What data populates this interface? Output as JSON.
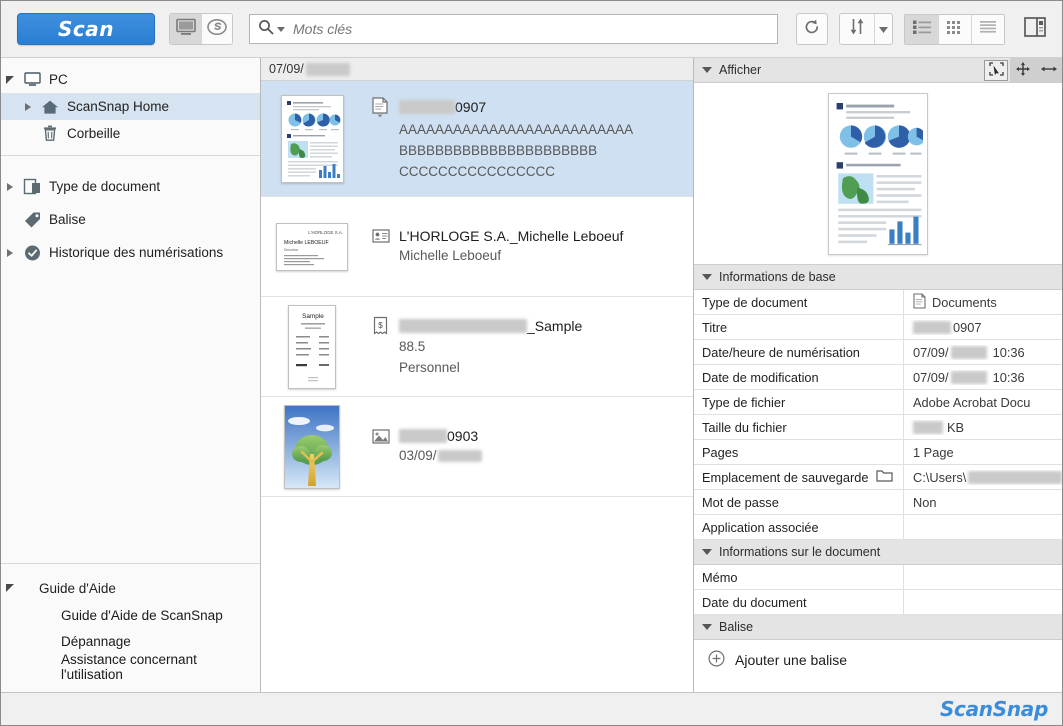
{
  "toolbar": {
    "scan_label": "Scan",
    "pc_mode_icon": "monitor-icon",
    "cloud_mode_icon": "scansnap-cloud-icon",
    "search_placeholder": "Mots clés",
    "search_value": "",
    "refresh_icon": "refresh-icon",
    "sort_icon": "sort-arrows-icon",
    "sort_caret_icon": "chevron-down-icon",
    "view_list_icon": "list-view-icon",
    "view_grid_icon": "grid-view-icon",
    "view_detail_icon": "detail-view-icon",
    "panel_toggle_icon": "side-panel-icon"
  },
  "sidebar": {
    "tree": [
      {
        "label": "PC",
        "icon": "monitor-icon",
        "twisty": "down",
        "indent": 0,
        "selected": false
      },
      {
        "label": "ScanSnap Home",
        "icon": "home-icon",
        "twisty": "right",
        "indent": 1,
        "selected": true
      },
      {
        "label": "Corbeille",
        "icon": "trash-icon",
        "twisty": "none",
        "indent": 1,
        "selected": false
      }
    ],
    "filters": [
      {
        "label": "Type de document",
        "icon": "document-type-icon",
        "twisty": "right"
      },
      {
        "label": "Balise",
        "icon": "tag-icon",
        "twisty": "none"
      },
      {
        "label": "Historique des numérisations",
        "icon": "history-icon",
        "twisty": "right"
      }
    ],
    "help": {
      "header": "Guide d'Aide",
      "links": [
        "Guide d'Aide de ScanSnap",
        "Dépannage",
        "Assistance concernant l'utilisation"
      ]
    }
  },
  "list": {
    "date_header": "07/09/",
    "date_header_redacted": true,
    "items": [
      {
        "title_prefix_redacted": true,
        "title": "0907",
        "lines": [
          "AAAAAAAAAAAAAAAAAAAAAAAAAA",
          "BBBBBBBBBBBBBBBBBBBBBB",
          "CCCCCCCCCCCCCCCC"
        ],
        "doc_icon": "document-icon",
        "thumb": "report-page",
        "selected": true
      },
      {
        "title_prefix_redacted": false,
        "title": "L'HORLOGE S.A._Michelle Leboeuf",
        "lines": [
          "Michelle Leboeuf"
        ],
        "doc_icon": "business-card-icon",
        "thumb": "business-card",
        "selected": false
      },
      {
        "title_prefix_redacted": true,
        "title": "_Sample",
        "lines": [
          "88.5",
          "Personnel"
        ],
        "doc_icon": "receipt-icon",
        "thumb": "receipt",
        "selected": false
      },
      {
        "title_prefix_redacted": true,
        "title": "0903",
        "lines": [
          "03/09/"
        ],
        "line_redacted": true,
        "doc_icon": "photo-icon",
        "thumb": "photo-tree",
        "selected": false
      }
    ]
  },
  "details": {
    "view_section": {
      "title": "Afficher",
      "select_icon": "select-area-icon",
      "pan_icon": "move-icon",
      "fit_icon": "fit-width-icon"
    },
    "basic_section": {
      "title": "Informations de base",
      "rows": [
        {
          "key": "Type de document",
          "value": "Documents",
          "icon": "document-icon"
        },
        {
          "key": "Titre",
          "value": "0907",
          "redact_before": true
        },
        {
          "key": "Date/heure de numérisation",
          "value_prefix": "07/09/",
          "value_suffix": "10:36",
          "redact_middle": true
        },
        {
          "key": "Date de modification",
          "value_prefix": "07/09/",
          "value_suffix": "10:36",
          "redact_middle": true
        },
        {
          "key": "Type de fichier",
          "value": "Adobe Acrobat Docu"
        },
        {
          "key": "Taille du fichier",
          "value": "KB",
          "redact_before": true
        },
        {
          "key": "Pages",
          "value": "1 Page"
        },
        {
          "key": "Emplacement de sauvegarde",
          "value": "C:\\Users\\",
          "icon_right": "folder-icon",
          "redact_after": true
        },
        {
          "key": "Mot de passe",
          "value": "Non"
        },
        {
          "key": "Application associée",
          "value": ""
        }
      ]
    },
    "document_section": {
      "title": "Informations sur le document",
      "rows": [
        {
          "key": "Mémo",
          "value": ""
        },
        {
          "key": "Date du document",
          "value": ""
        }
      ]
    },
    "tag_section": {
      "title": "Balise",
      "add_label": "Ajouter une balise",
      "add_icon": "plus-circle-icon"
    }
  },
  "footer": {
    "brand": "ScanSnap"
  },
  "colors": {
    "accent_blue": "#2a7fd4",
    "selection_blue": "#cfe0f2",
    "nav_selection": "#d6e3f0",
    "brand_blue": "#3a8ddb"
  }
}
